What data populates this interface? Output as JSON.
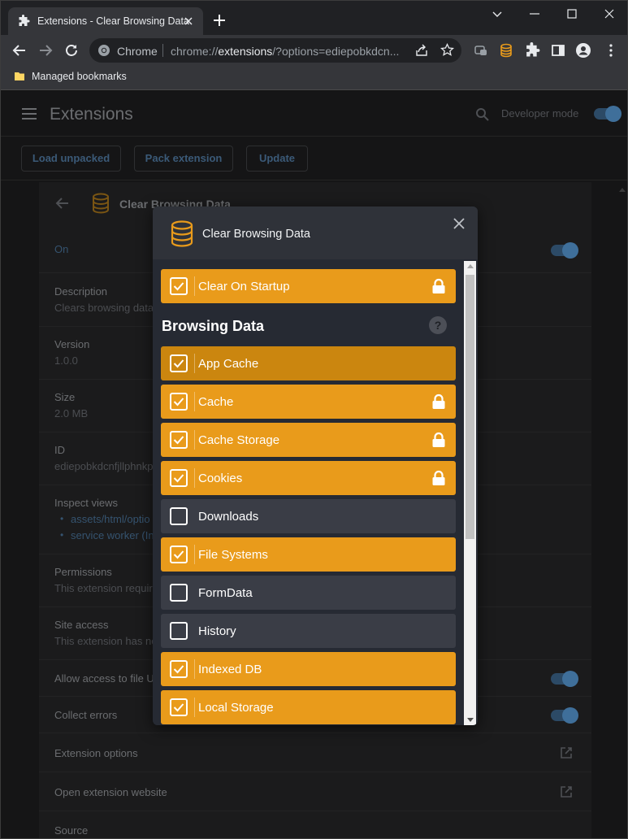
{
  "browser": {
    "tab_title": "Extensions - Clear Browsing Data",
    "site_label": "Chrome",
    "url_scheme": "chrome://",
    "url_host": "extensions",
    "url_rest": "/?options=ediepobkdcn...",
    "bookmarks_folder": "Managed bookmarks"
  },
  "extensions_page": {
    "title": "Extensions",
    "dev_mode_label": "Developer mode",
    "buttons": {
      "load_unpacked": "Load unpacked",
      "pack_extension": "Pack extension",
      "update": "Update"
    },
    "extension_name": "Clear Browsing Data",
    "status": "On",
    "rows": {
      "description_label": "Description",
      "description_value": "Clears browsing data",
      "version_label": "Version",
      "version_value": "1.0.0",
      "size_label": "Size",
      "size_value": "2.0 MB",
      "id_label": "ID",
      "id_value": "ediepobkdcnfjllphnkp",
      "inspect_label": "Inspect views",
      "inspect_link_1": "assets/html/optio",
      "inspect_link_2": "service worker (In",
      "permissions_label": "Permissions",
      "permissions_value": "This extension requir",
      "site_access_label": "Site access",
      "site_access_value": "This extension has no",
      "file_urls_label": "Allow access to file U",
      "collect_errors_label": "Collect errors",
      "ext_options_label": "Extension options",
      "website_label": "Open extension website",
      "source_label": "Source"
    }
  },
  "dialog": {
    "title": "Clear Browsing Data",
    "startup_option": {
      "label": "Clear On Startup",
      "checked": true,
      "locked": true
    },
    "section_title": "Browsing Data",
    "help_symbol": "?",
    "options": [
      {
        "label": "App Cache",
        "checked": true,
        "locked": false
      },
      {
        "label": "Cache",
        "checked": true,
        "locked": true
      },
      {
        "label": "Cache Storage",
        "checked": true,
        "locked": true
      },
      {
        "label": "Cookies",
        "checked": true,
        "locked": true
      },
      {
        "label": "Downloads",
        "checked": false,
        "locked": false
      },
      {
        "label": "File Systems",
        "checked": true,
        "locked": false
      },
      {
        "label": "FormData",
        "checked": false,
        "locked": false
      },
      {
        "label": "History",
        "checked": false,
        "locked": false
      },
      {
        "label": "Indexed DB",
        "checked": true,
        "locked": false
      },
      {
        "label": "Local Storage",
        "checked": true,
        "locked": false
      }
    ]
  },
  "colors": {
    "accent": "#e99b1b",
    "unchecked": "#3a3d46",
    "dialog_bg": "#262a33"
  }
}
